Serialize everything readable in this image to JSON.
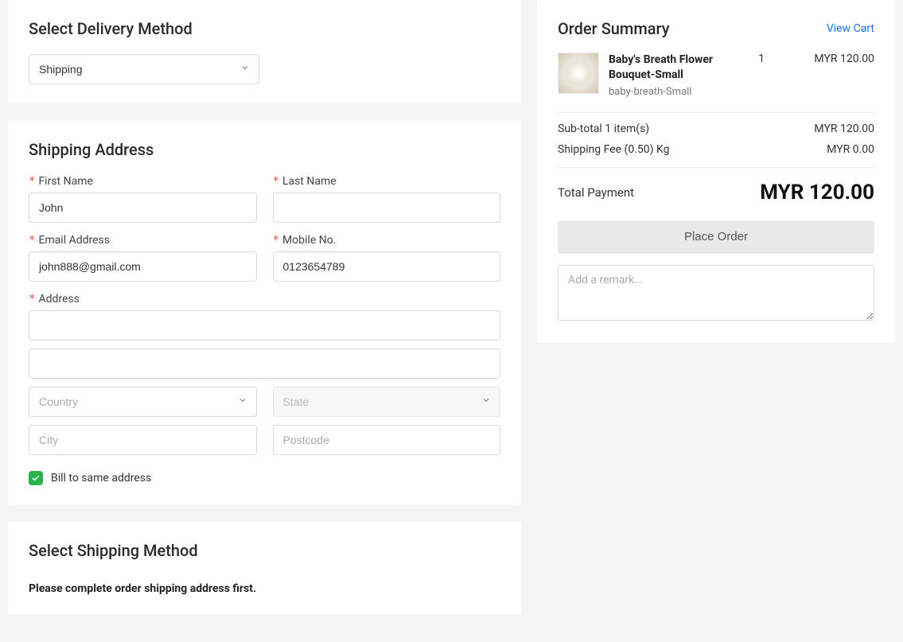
{
  "delivery": {
    "title": "Select Delivery Method",
    "selected": "Shipping"
  },
  "shipping_address": {
    "title": "Shipping Address",
    "first_name_label": "First Name",
    "first_name_value": "John",
    "last_name_label": "Last Name",
    "last_name_value": "",
    "email_label": "Email Address",
    "email_value": "john888@gmail.com",
    "mobile_label": "Mobile No.",
    "mobile_value": "0123654789",
    "address_label": "Address",
    "country_placeholder": "Country",
    "state_placeholder": "State",
    "city_placeholder": "City",
    "postcode_placeholder": "Postcode",
    "bill_same_label": "Bill to same address"
  },
  "shipping_method": {
    "title": "Select Shipping Method",
    "message": "Please complete order shipping address first."
  },
  "summary": {
    "title": "Order Summary",
    "view_cart": "View Cart",
    "item": {
      "name": "Baby's Breath Flower Bouquet-Small",
      "sku": "baby-breath-Small",
      "qty": "1",
      "price": "MYR 120.00"
    },
    "subtotal_label": "Sub-total 1 item(s)",
    "subtotal_value": "MYR 120.00",
    "shipping_fee_label": "Shipping Fee (0.50) Kg",
    "shipping_fee_value": "MYR 0.00",
    "total_label": "Total Payment",
    "total_value": "MYR 120.00",
    "place_order": "Place Order",
    "remark_placeholder": "Add a remark..."
  }
}
